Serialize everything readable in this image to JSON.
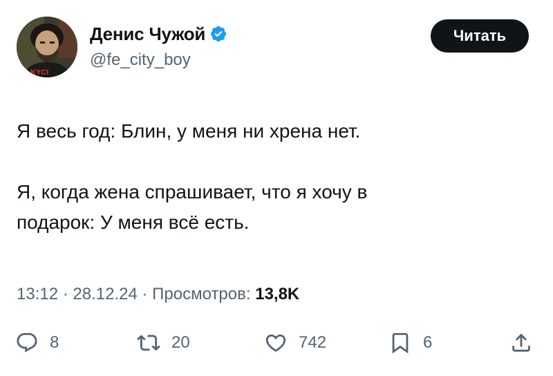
{
  "author": {
    "display_name": "Денис Чужой",
    "handle": "@fe_city_boy",
    "verified": true,
    "avatar_shirt_text": "KYCI"
  },
  "follow_button": {
    "label": "Читать"
  },
  "tweet": {
    "paragraphs": [
      [
        "Я весь год: Блин, у меня ни хрена нет."
      ],
      [
        "Я, когда жена спрашивает, что я хочу в",
        "подарок: У меня всё есть."
      ]
    ]
  },
  "meta": {
    "time": "13:12",
    "separator": "·",
    "date": "28.12.24",
    "views_label": "Просмотров:",
    "views_count": "13,8K"
  },
  "actions": {
    "reply": {
      "icon": "reply-icon",
      "count": "8"
    },
    "retweet": {
      "icon": "retweet-icon",
      "count": "20"
    },
    "like": {
      "icon": "heart-icon",
      "count": "742"
    },
    "bookmark": {
      "icon": "bookmark-icon",
      "count": "6"
    },
    "share": {
      "icon": "share-icon"
    }
  },
  "colors": {
    "text": "#0f1419",
    "secondary": "#536471",
    "verified": "#1d9bf0",
    "button_bg": "#0f1419"
  }
}
